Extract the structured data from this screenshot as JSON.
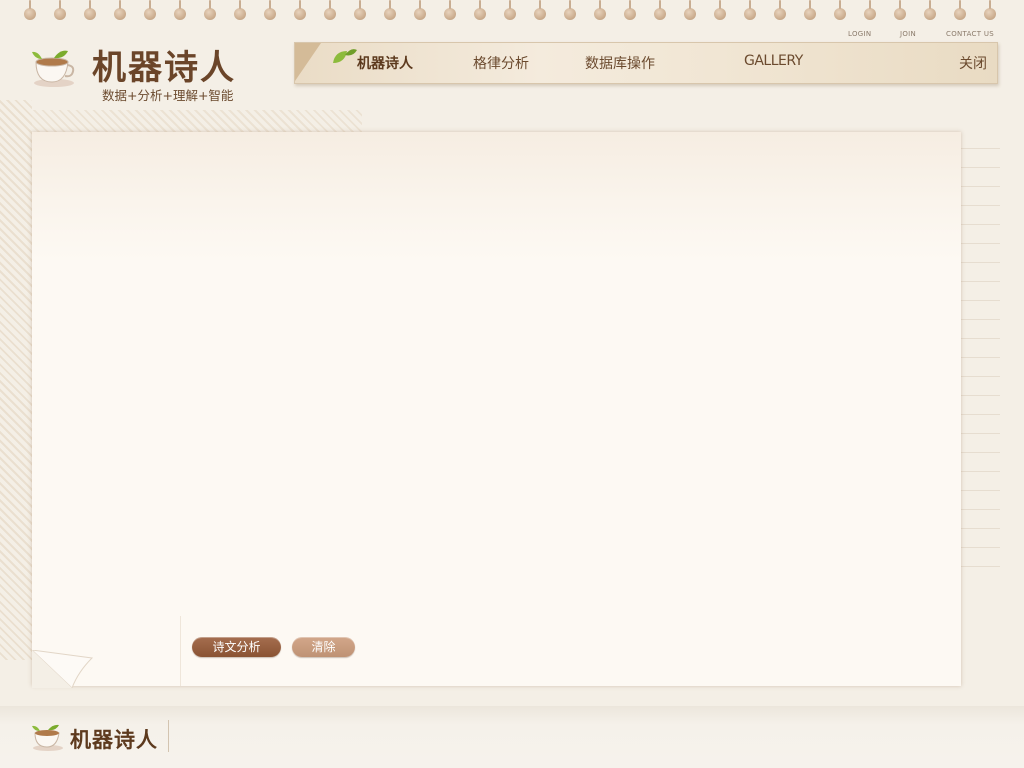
{
  "top_links": [
    "LOGIN",
    "JOIN",
    "CONTACT US"
  ],
  "logo": {
    "title": "机器诗人",
    "subtitle": "数据+分析+理解+智能"
  },
  "nav": {
    "items": [
      {
        "label": "机器诗人",
        "active": true
      },
      {
        "label": "格律分析"
      },
      {
        "label": "数据库操作"
      },
      {
        "label": "GALLERY"
      }
    ],
    "close_label": "关闭"
  },
  "buttons": {
    "analyze_label": "诗文分析",
    "clear_label": "清除"
  },
  "footer": {
    "title": "机器诗人"
  },
  "icons": {
    "logo": "teacup-leaf-icon",
    "nav": "leaf-icon"
  },
  "colors": {
    "accent": "#8a5333",
    "background": "#f4efe6",
    "paper": "#fdf9f3"
  }
}
